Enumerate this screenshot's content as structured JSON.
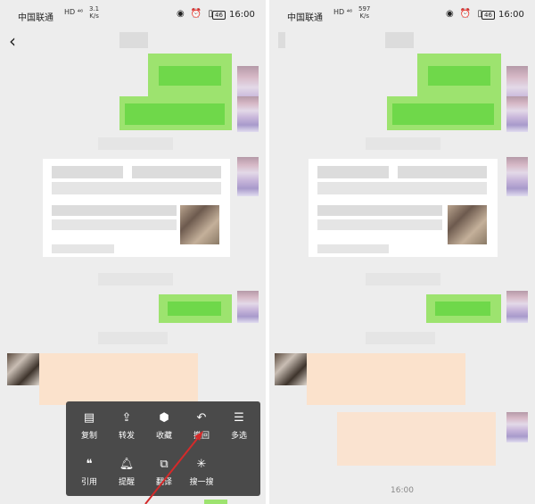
{
  "status_bar": {
    "carrier": "中国联通",
    "net_badge": "HD ⁴⁶",
    "left_speed": "3.1\nK/s",
    "right_speed": "597\nK/s",
    "battery": "46",
    "time": "16:00"
  },
  "context_menu": {
    "items": [
      {
        "label": "复制",
        "icon": "copy-icon"
      },
      {
        "label": "转发",
        "icon": "forward-icon"
      },
      {
        "label": "收藏",
        "icon": "favorite-cube-icon"
      },
      {
        "label": "撤回",
        "icon": "recall-icon"
      },
      {
        "label": "多选",
        "icon": "multi-select-icon"
      },
      {
        "label": "引用",
        "icon": "quote-icon"
      },
      {
        "label": "提醒",
        "icon": "bell-icon"
      },
      {
        "label": "翻译",
        "icon": "translate-icon"
      },
      {
        "label": "搜一搜",
        "icon": "search-star-icon"
      }
    ]
  },
  "right_pane": {
    "timestamp": "16:00"
  },
  "colors": {
    "chat_bg": "#ededed",
    "sent_bubble": "#9de36f",
    "menu_bg": "#4a4a4a",
    "annotation_arrow": "#d42a2a"
  }
}
